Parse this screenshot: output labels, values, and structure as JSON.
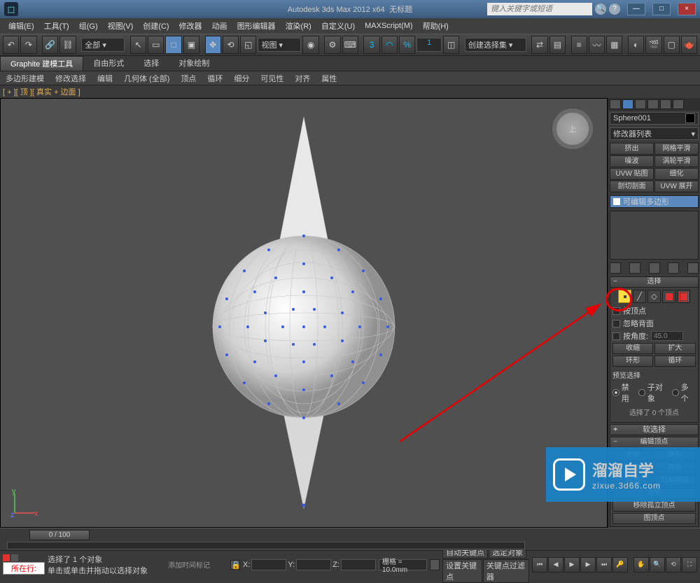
{
  "titlebar": {
    "app_title": "Autodesk 3ds Max  2012 x64",
    "doc_title": "无标题",
    "search_placeholder": "键入关键字或短语",
    "min": "—",
    "max": "□",
    "close": "×"
  },
  "menubar": [
    "编辑(E)",
    "工具(T)",
    "组(G)",
    "视图(V)",
    "创建(C)",
    "修改器",
    "动画",
    "图形编辑器",
    "渲染(R)",
    "自定义(U)",
    "MAXScript(M)",
    "帮助(H)"
  ],
  "toolbar": {
    "scope_dd": "全部 ▾",
    "view_dd": "视图 ▾",
    "selset_dd": "创建选择集 ▾",
    "spinner_val": "1"
  },
  "ribbon": {
    "tabs": [
      "Graphite 建模工具",
      "自由形式",
      "选择",
      "对象绘制"
    ],
    "menus": [
      "多边形建模",
      "修改选择",
      "编辑",
      "几何体 (全部)",
      "顶点",
      "循环",
      "细分",
      "可见性",
      "对齐",
      "属性"
    ]
  },
  "viewport_label": "[ + ][ 顶 ][ 真实 + 边面 ]",
  "viewcube_label": "上",
  "right_panel": {
    "object_name": "Sphere001",
    "modifier_dd": "修改器列表",
    "quick_mods": [
      "挤出",
      "网格平滑",
      "噪波",
      "涡轮平滑",
      "UVW 贴图",
      "细化",
      "剖切剖面",
      "UVW 展开"
    ],
    "stack_item": "可编辑多边形",
    "rollouts": {
      "selection": {
        "title": "选择",
        "by_vertex": "按顶点",
        "ignore_back": "忽略背面",
        "by_angle": "按角度:",
        "angle_val": "45.0",
        "shrink": "收缩",
        "grow": "扩大",
        "ring": "环形",
        "loop": "循环",
        "preview_label": "预览选择",
        "preview_off": "禁用",
        "preview_sub": "子对象",
        "preview_multi": "多个",
        "selected_info": "选择了 0 个顶点"
      },
      "soft": {
        "title": "软选择"
      },
      "edit_vertex": {
        "title": "编辑顶点",
        "remove": "移除",
        "break": "断开",
        "extrude": "挤出",
        "weld": "焊接",
        "chamfer": "切角",
        "target_weld": "目标焊接",
        "connect": "连接",
        "remove_iso": "移除孤立顶点",
        "pin": "图顶点"
      }
    }
  },
  "timeline": {
    "frame_label": "0 / 100"
  },
  "status": {
    "script_tab": "所在行:",
    "line1": "选择了 1 个对象",
    "line2": "单击或单击并拖动以选择对象",
    "timelabel": "添加时间标记",
    "x": "X:",
    "y": "Y:",
    "z": "Z:",
    "grid": "栅格 = 10.0mm",
    "autokey": "自动关键点",
    "selkey": "选定对象",
    "setkey": "设置关键点",
    "keyfilter": "关键点过滤器"
  },
  "watermark": {
    "name": "溜溜自学",
    "url": "zixue.3d66.com"
  }
}
